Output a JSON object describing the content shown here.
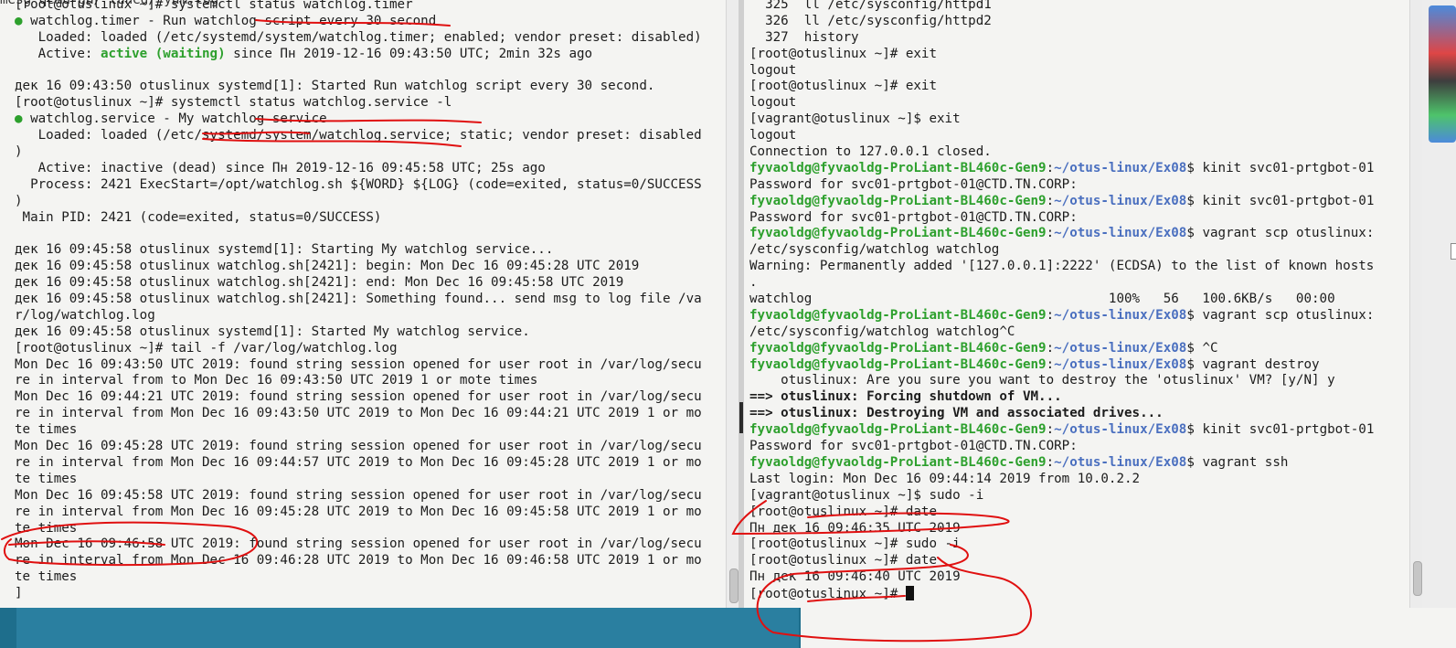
{
  "left_terminal": {
    "top_ghost": "mesg          qemu-ga/              tuned/           yum.log",
    "lines": [
      "[root@otuslinux ~]# systemctl status watchlog.timer",
      "● watchlog.timer - Run watchlog script every 30 second",
      "   Loaded: loaded (/etc/systemd/system/watchlog.timer; enabled; vendor preset: disabled)",
      "   Active: active (waiting) since Пн 2019-12-16 09:43:50 UTC; 2min 32s ago",
      "",
      "дек 16 09:43:50 otuslinux systemd[1]: Started Run watchlog script every 30 second.",
      "[root@otuslinux ~]# systemctl status watchlog.service -l",
      "● watchlog.service - My watchlog service",
      "   Loaded: loaded (/etc/systemd/system/watchlog.service; static; vendor preset: disabled",
      ")",
      "   Active: inactive (dead) since Пн 2019-12-16 09:45:58 UTC; 25s ago",
      "  Process: 2421 ExecStart=/opt/watchlog.sh ${WORD} ${LOG} (code=exited, status=0/SUCCESS",
      ")",
      " Main PID: 2421 (code=exited, status=0/SUCCESS)",
      "",
      "дек 16 09:45:58 otuslinux systemd[1]: Starting My watchlog service...",
      "дек 16 09:45:58 otuslinux watchlog.sh[2421]: begin: Mon Dec 16 09:45:28 UTC 2019",
      "дек 16 09:45:58 otuslinux watchlog.sh[2421]: end: Mon Dec 16 09:45:58 UTC 2019",
      "дек 16 09:45:58 otuslinux watchlog.sh[2421]: Something found... send msg to log file /va",
      "r/log/watchlog.log",
      "дек 16 09:45:58 otuslinux systemd[1]: Started My watchlog service.",
      "[root@otuslinux ~]# tail -f /var/log/watchlog.log",
      "Mon Dec 16 09:43:50 UTC 2019: found string session opened for user root in /var/log/secu",
      "re in interval from to Mon Dec 16 09:43:50 UTC 2019 1 or mote times",
      "Mon Dec 16 09:44:21 UTC 2019: found string session opened for user root in /var/log/secu",
      "re in interval from Mon Dec 16 09:43:50 UTC 2019 to Mon Dec 16 09:44:21 UTC 2019 1 or mo",
      "te times",
      "Mon Dec 16 09:45:28 UTC 2019: found string session opened for user root in /var/log/secu",
      "re in interval from Mon Dec 16 09:44:57 UTC 2019 to Mon Dec 16 09:45:28 UTC 2019 1 or mo",
      "te times",
      "Mon Dec 16 09:45:58 UTC 2019: found string session opened for user root in /var/log/secu",
      "re in interval from Mon Dec 16 09:45:28 UTC 2019 to Mon Dec 16 09:45:58 UTC 2019 1 or mo",
      "te times",
      "Mon Dec 16 09:46:58 UTC 2019: found string session opened for user root in /var/log/secu",
      "re in interval from Mon Dec 16 09:46:28 UTC 2019 to Mon Dec 16 09:46:58 UTC 2019 1 or mo",
      "te times",
      "]"
    ],
    "active_status": "active (waiting)"
  },
  "right_terminal": {
    "lines": [
      "  325  ll /etc/sysconfig/httpd1",
      "  326  ll /etc/sysconfig/httpd2",
      "  327  history",
      "[root@otuslinux ~]# exit",
      "logout",
      "[root@otuslinux ~]# exit",
      "logout",
      "[vagrant@otuslinux ~]$ exit",
      "logout",
      "Connection to 127.0.0.1 closed.",
      "fyvaoldg@fyvaoldg-ProLiant-BL460c-Gen9:~/otus-linux/Ex08$ kinit svc01-prtgbot-01",
      "Password for svc01-prtgbot-01@CTD.TN.CORP:",
      "fyvaoldg@fyvaoldg-ProLiant-BL460c-Gen9:~/otus-linux/Ex08$ kinit svc01-prtgbot-01",
      "Password for svc01-prtgbot-01@CTD.TN.CORP:",
      "fyvaoldg@fyvaoldg-ProLiant-BL460c-Gen9:~/otus-linux/Ex08$ vagrant scp otuslinux:",
      "/etc/sysconfig/watchlog watchlog",
      "Warning: Permanently added '[127.0.0.1]:2222' (ECDSA) to the list of known hosts",
      ".",
      "watchlog                                      100%   56   100.6KB/s   00:00",
      "fyvaoldg@fyvaoldg-ProLiant-BL460c-Gen9:~/otus-linux/Ex08$ vagrant scp otuslinux:",
      "/etc/sysconfig/watchlog watchlog^C",
      "fyvaoldg@fyvaoldg-ProLiant-BL460c-Gen9:~/otus-linux/Ex08$ ^C",
      "fyvaoldg@fyvaoldg-ProLiant-BL460c-Gen9:~/otus-linux/Ex08$ vagrant destroy",
      "    otuslinux: Are you sure you want to destroy the 'otuslinux' VM? [y/N] y",
      "==> otuslinux: Forcing shutdown of VM...",
      "==> otuslinux: Destroying VM and associated drives...",
      "fyvaoldg@fyvaoldg-ProLiant-BL460c-Gen9:~/otus-linux/Ex08$ kinit svc01-prtgbot-01",
      "Password for svc01-prtgbot-01@CTD.TN.CORP:",
      "fyvaoldg@fyvaoldg-ProLiant-BL460c-Gen9:~/otus-linux/Ex08$ vagrant ssh",
      "Last login: Mon Dec 16 09:44:14 2019 from 10.0.2.2",
      "[vagrant@otuslinux ~]$ sudo -i",
      "[root@otuslinux ~]# date",
      "Пн дек 16 09:46:35 UTC 2019",
      "[root@otuslinux ~]# sudo -i",
      "[root@otuslinux ~]# date",
      "Пн дек 16 09:46:40 UTC 2019",
      "[root@otuslinux ~]# "
    ],
    "prompt_user_host": "fyvaoldg@fyvaoldg-ProLiant-BL460c-Gen9",
    "prompt_path": "~/otus-linux/Ex08"
  },
  "colors": {
    "terminal_bg": "#f4f4f2",
    "prompt_green": "#2da02d",
    "path_blue": "#4a6fbf",
    "annotation_red": "#e01010",
    "desktop": "#2b7d9e"
  },
  "icons": [
    "cursor-block-icon",
    "mascot-sticker-icon"
  ]
}
